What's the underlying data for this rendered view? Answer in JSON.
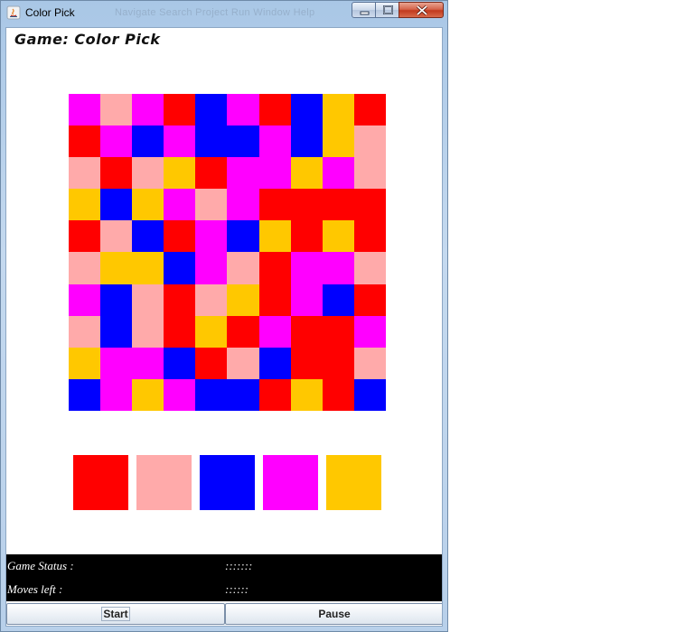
{
  "window": {
    "title": "Color Pick",
    "ghost_menu": "Navigate   Search   Project   Run   Window   Help"
  },
  "game": {
    "title": "Game: Color Pick",
    "palette_codes": {
      "R": "#ff0000",
      "P": "#ffaaaa",
      "B": "#0000ff",
      "M": "#ff00ff",
      "Y": "#ffc800"
    },
    "board": [
      "MPMRBMRBYR",
      "RMBMBBMBYP",
      "PRPYRMMYMP",
      "YBYMPMRRRR",
      "RPBRMBYRYR",
      "PYYBMPRMMP",
      "MBPRPYRMBR",
      "PBPRYRMRRM",
      "YMMBRPBRRP",
      "BMYMBBRYRB"
    ],
    "swatches": [
      {
        "name": "red",
        "color": "#ff0000"
      },
      {
        "name": "pink",
        "color": "#ffaaaa"
      },
      {
        "name": "blue",
        "color": "#0000ff"
      },
      {
        "name": "magenta",
        "color": "#ff00ff"
      },
      {
        "name": "yellow",
        "color": "#ffc800"
      }
    ]
  },
  "status": {
    "game_status_label": "Game Status :",
    "game_status_value": ":::::::",
    "moves_left_label": "Moves left :",
    "moves_left_value": "::::::"
  },
  "buttons": {
    "start_label": "Start",
    "pause_label": "Pause"
  }
}
